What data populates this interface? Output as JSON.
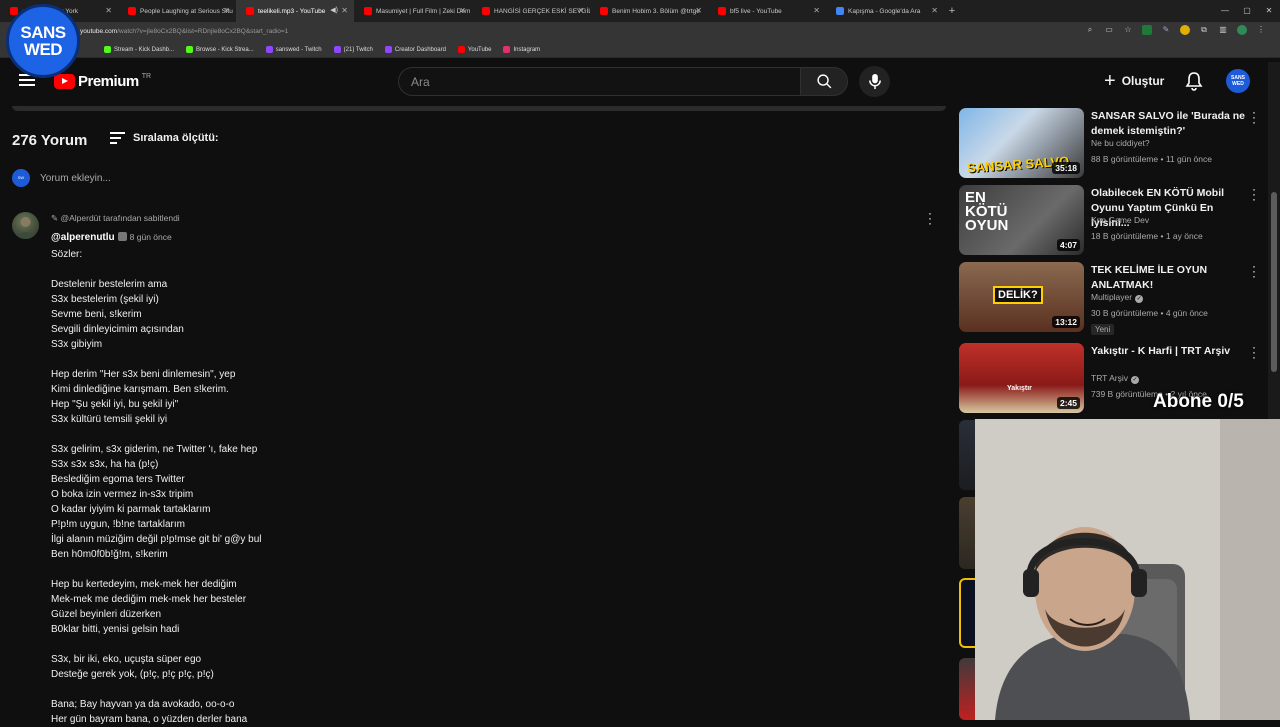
{
  "browser": {
    "tabs": [
      {
        "title": "chman In New York",
        "color": "#ff0000"
      },
      {
        "title": "People Laughing at Serious Situ",
        "color": "#ff0000"
      },
      {
        "title": "teelikeli.mp3 - YouTube",
        "color": "#ff0000",
        "active": true
      },
      {
        "title": "Masumiyet | Full Film | Zeki Dem",
        "color": "#ff0000"
      },
      {
        "title": "HANGİSİ GERÇEK ESKİ SEVGİLİ",
        "color": "#ff0000"
      },
      {
        "title": "Benim Hobim 3. Bölüm @trtge",
        "color": "#ff0000"
      },
      {
        "title": "bf5 live - YouTube",
        "color": "#ff0000"
      },
      {
        "title": "Kapışma - Google'da Ara",
        "color": "#4285f4"
      }
    ],
    "url_host": "youtube.com",
    "url_path": "/watch?v=jIe8oCx2BQ&list=RDnjIe8oCx2BQ&start_radio=1",
    "bookmarks": [
      {
        "label": "Stream - Kick Dashb...",
        "color": "#53fc18"
      },
      {
        "label": "Browse - Kick Strea...",
        "color": "#53fc18"
      },
      {
        "label": "sanswed - Twitch",
        "color": "#9146ff"
      },
      {
        "label": "(21) Twitch",
        "color": "#9146ff"
      },
      {
        "label": "Creator Dashboard",
        "color": "#9146ff"
      },
      {
        "label": "YouTube",
        "color": "#ff0000"
      },
      {
        "label": "Instagram",
        "color": "#e1306c"
      }
    ]
  },
  "stream_logo": {
    "line1": "SANS",
    "line2": "WED"
  },
  "header": {
    "brand": "Premium",
    "region": "TR",
    "search_placeholder": "Ara",
    "create_label": "Oluştur",
    "avatar_text": "SANS WED"
  },
  "comments": {
    "count": "276 Yorum",
    "sort_label": "Sıralama ölçütü:",
    "add_placeholder": "Yorum ekleyin...",
    "pinned": {
      "pinned_by": "@Alperdüt tarafından sabitlendi",
      "author": "@alperenutlu",
      "age": "8 gün önce",
      "lines": [
        "Sözler:",
        "",
        "Destelenir bestelerim ama",
        "S3x bestelerim (şekil iyi)",
        "Sevme beni, s!kerim",
        "Sevgili dinleyicimim açısından",
        "S3x gibiyim",
        "",
        "Hep derim \"Her s3x beni dinlemesin\", yep",
        "Kimi dinlediğine karışmam. Ben s!kerim.",
        "Hep \"Şu şekil iyi, bu şekil iyi\"",
        "S3x kültürü temsili şekil iyi",
        "",
        "S3x gelirim, s3x giderim, ne Twitter 'ı, fake hep",
        "S3x s3x s3x, ha ha (p!ç)",
        "Beslediğim egoma ters Twitter",
        "O boka izin vermez in-s3x tripim",
        "O kadar iyiyim ki parmak tartaklarım",
        "P!p!m uygun, !b!ne tartaklarım",
        "İlgi alanın müziğim değil p!p!mse git bi' g@y bul",
        "Ben h0m0f0b!ğ!m, s!kerim",
        "",
        "Hep bu kertedeyim, mek-mek her dediğim",
        "Mek-mek me dediğim mek-mek her besteler",
        "Güzel beyinleri düzerken",
        "B0klar bitti, yenisi gelsin hadi",
        "",
        "S3x, bir iki, eko, uçuşta süper ego",
        "Desteğe gerek yok, (p!ç, p!ç p!ç, p!ç)",
        "",
        "Bana; Bay hayvan ya da avokado, oo-o-o",
        "Her gün bayram bana, o yüzden derler bana"
      ]
    }
  },
  "recommendations": [
    {
      "title": "SANSAR SALVO ile 'Burada ne demek istemiştin?'",
      "channel": "Ne bu ciddiyet?",
      "views": "88 B görüntüleme",
      "age": "11 gün önce",
      "duration": "35:18",
      "thumb_text": "SANSAR SALVO",
      "verified": false,
      "is_new": false
    },
    {
      "title": "Olabilecek EN KÖTÜ Mobil Oyunu Yaptım Çünkü En İyisini...",
      "channel": "Knn Game Dev",
      "views": "18 B görüntüleme",
      "age": "1 ay önce",
      "duration": "4:07",
      "thumb_text": "EN KÖTÜ OYUN",
      "verified": false,
      "is_new": false
    },
    {
      "title": "TEK KELİME İLE OYUN ANLATMAK!",
      "channel": "Multiplayer",
      "views": "30 B görüntüleme",
      "age": "4 gün önce",
      "duration": "13:12",
      "thumb_text": "DELİK?",
      "verified": true,
      "is_new": true,
      "new_label": "Yeni"
    },
    {
      "title": "Yakıştır - K Harfi | TRT Arşiv",
      "channel": "TRT Arşiv",
      "views": "739 B görüntüleme",
      "age": "2 yıl önce",
      "duration": "2:45",
      "thumb_text": "Yakıştır",
      "verified": true,
      "is_new": false
    }
  ],
  "overlay": {
    "abone": "Abone 0/5"
  },
  "colors": {
    "accent": "#ff0000",
    "background": "#0f0f0f",
    "avatar": "#1e5bd8"
  }
}
